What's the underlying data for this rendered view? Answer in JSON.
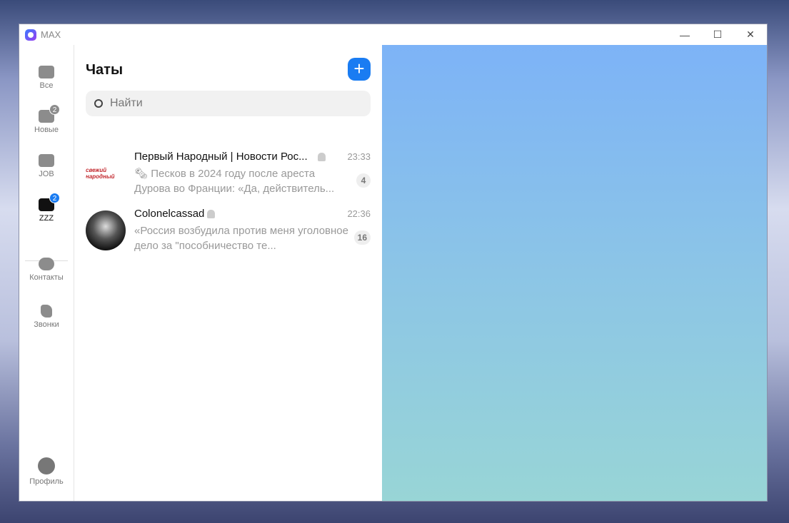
{
  "window": {
    "title": "MAX",
    "minimize": "—",
    "maximize": "☐",
    "close": "✕"
  },
  "sidebar": {
    "items": [
      {
        "label": "Все",
        "icon": "chat-bubble-icon"
      },
      {
        "label": "Новые",
        "icon": "folder-icon",
        "badge": "2"
      },
      {
        "label": "JOB",
        "icon": "folder-icon"
      },
      {
        "label": "ZZZ",
        "icon": "folder-open-icon",
        "badge": "2"
      },
      {
        "label": "Контакты",
        "icon": "contacts-icon"
      },
      {
        "label": "Звонки",
        "icon": "phone-icon"
      },
      {
        "label": "Профиль",
        "icon": "profile-icon"
      }
    ]
  },
  "chats": {
    "title": "Чаты",
    "add": "+",
    "search_placeholder": "Найти",
    "items": [
      {
        "name": "Первый Народный | Новости Рос...",
        "time": "23:33",
        "preview": "🗞 Песков в 2024 году после ареста Дурова во Франции:   «Да, действитель...",
        "unread": "4",
        "muted": true,
        "logo_text": "свежий народный"
      },
      {
        "name": "Colonelcassad",
        "time": "22:36",
        "preview": "«Россия возбудила против меня уголовное дело за \"пособничество те...",
        "unread": "16",
        "muted": true
      }
    ]
  },
  "colors": {
    "accent": "#1a7cf2"
  }
}
